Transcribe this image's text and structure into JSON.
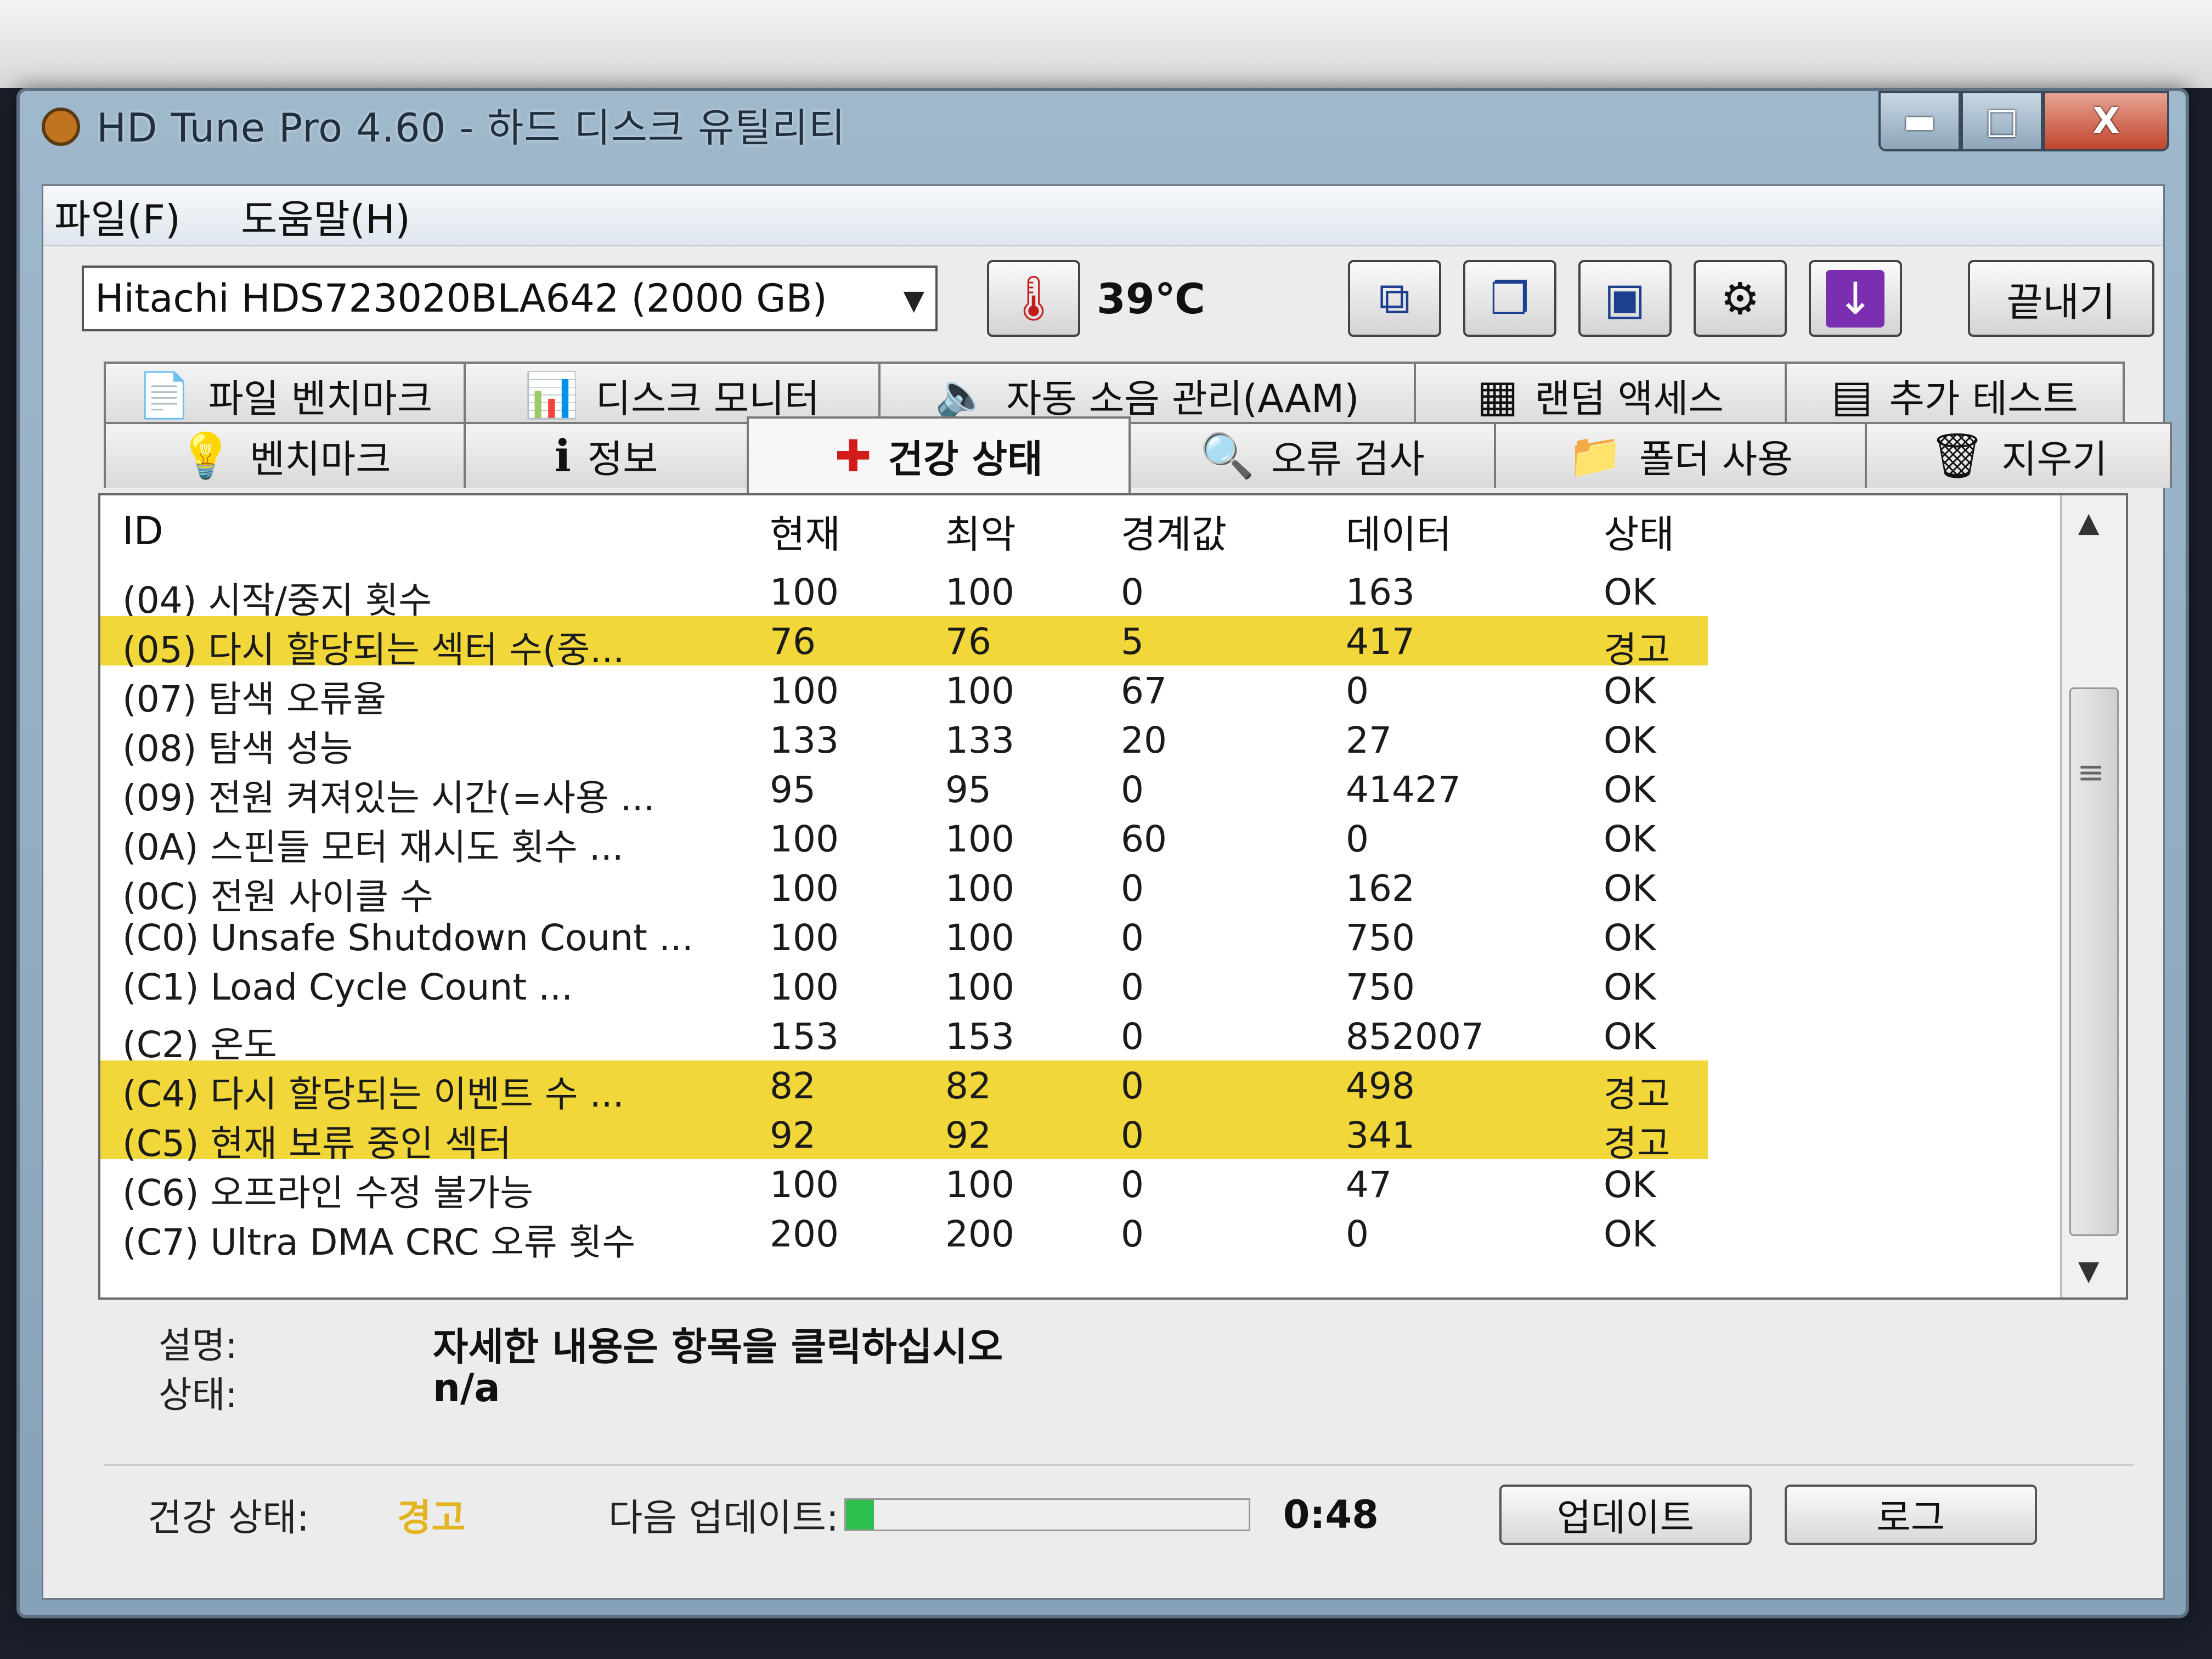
{
  "window": {
    "title": "HD Tune Pro 4.60 - 하드 디스크 유틸리티",
    "controls": {
      "minimize": "▬",
      "maximize": "□",
      "close": "X"
    }
  },
  "menu": {
    "file": "파일(F)",
    "help": "도움말(H)"
  },
  "toolbar": {
    "drive": "Hitachi HDS723020BLA642 (2000 GB)",
    "temperature": "39℃",
    "exit_label": "끝내기"
  },
  "tabs_top": [
    {
      "label": "파일 벤치마크",
      "icon": "file-benchmark-icon"
    },
    {
      "label": "디스크 모니터",
      "icon": "disk-monitor-icon"
    },
    {
      "label": "자동 소음 관리(AAM)",
      "icon": "speaker-icon"
    },
    {
      "label": "랜덤 액세스",
      "icon": "random-access-icon"
    },
    {
      "label": "추가 테스트",
      "icon": "extra-tests-icon"
    }
  ],
  "tabs_bottom": [
    {
      "label": "벤치마크",
      "icon": "benchmark-icon"
    },
    {
      "label": "정보",
      "icon": "info-icon"
    },
    {
      "label": "건강 상태",
      "icon": "health-icon"
    },
    {
      "label": "오류 검사",
      "icon": "error-scan-icon"
    },
    {
      "label": "폴더 사용",
      "icon": "folder-usage-icon"
    },
    {
      "label": "지우기",
      "icon": "erase-icon"
    }
  ],
  "table": {
    "headers": {
      "id": "ID",
      "current": "현재",
      "worst": "최악",
      "threshold": "경계값",
      "data": "데이터",
      "status": "상태"
    },
    "rows": [
      {
        "id": "(04) 시작/중지 횟수",
        "current": "100",
        "worst": "100",
        "threshold": "0",
        "data": "163",
        "status": "OK",
        "warn": false
      },
      {
        "id": "(05) 다시 할당되는 섹터 수(중...",
        "current": "76",
        "worst": "76",
        "threshold": "5",
        "data": "417",
        "status": "경고",
        "warn": true
      },
      {
        "id": "(07) 탐색 오류율",
        "current": "100",
        "worst": "100",
        "threshold": "67",
        "data": "0",
        "status": "OK",
        "warn": false
      },
      {
        "id": "(08) 탐색 성능",
        "current": "133",
        "worst": "133",
        "threshold": "20",
        "data": "27",
        "status": "OK",
        "warn": false
      },
      {
        "id": "(09) 전원 켜져있는 시간(=사용 ...",
        "current": "95",
        "worst": "95",
        "threshold": "0",
        "data": "41427",
        "status": "OK",
        "warn": false
      },
      {
        "id": "(0A) 스핀들 모터 재시도 횟수 ...",
        "current": "100",
        "worst": "100",
        "threshold": "60",
        "data": "0",
        "status": "OK",
        "warn": false
      },
      {
        "id": "(0C) 전원 사이클 수",
        "current": "100",
        "worst": "100",
        "threshold": "0",
        "data": "162",
        "status": "OK",
        "warn": false
      },
      {
        "id": "(C0) Unsafe Shutdown Count ...",
        "current": "100",
        "worst": "100",
        "threshold": "0",
        "data": "750",
        "status": "OK",
        "warn": false
      },
      {
        "id": "(C1) Load Cycle Count ...",
        "current": "100",
        "worst": "100",
        "threshold": "0",
        "data": "750",
        "status": "OK",
        "warn": false
      },
      {
        "id": "(C2) 온도",
        "current": "153",
        "worst": "153",
        "threshold": "0",
        "data": "852007",
        "status": "OK",
        "warn": false
      },
      {
        "id": "(C4) 다시 할당되는 이벤트 수 ...",
        "current": "82",
        "worst": "82",
        "threshold": "0",
        "data": "498",
        "status": "경고",
        "warn": true
      },
      {
        "id": "(C5) 현재 보류 중인 섹터",
        "current": "92",
        "worst": "92",
        "threshold": "0",
        "data": "341",
        "status": "경고",
        "warn": true
      },
      {
        "id": "(C6) 오프라인 수정 불가능",
        "current": "100",
        "worst": "100",
        "threshold": "0",
        "data": "47",
        "status": "OK",
        "warn": false
      },
      {
        "id": "(C7) Ultra DMA CRC 오류 횟수",
        "current": "200",
        "worst": "200",
        "threshold": "0",
        "data": "0",
        "status": "OK",
        "warn": false
      }
    ]
  },
  "description": {
    "desc_label": "설명:",
    "desc_value": "자세한 내용은 항목을 클릭하십시오",
    "status_label": "상태:",
    "status_value": "n/a"
  },
  "statusbar": {
    "health_label": "건강 상태:",
    "health_value": "경고",
    "next_update_label": "다음 업데이트:",
    "progress_fraction": 0.07,
    "time": "0:48",
    "update_button": "업데이트",
    "log_button": "로그"
  },
  "colors": {
    "warn_highlight": "#f1d73a",
    "warn_text": "#e2b520",
    "progress": "#2fbf4e"
  }
}
